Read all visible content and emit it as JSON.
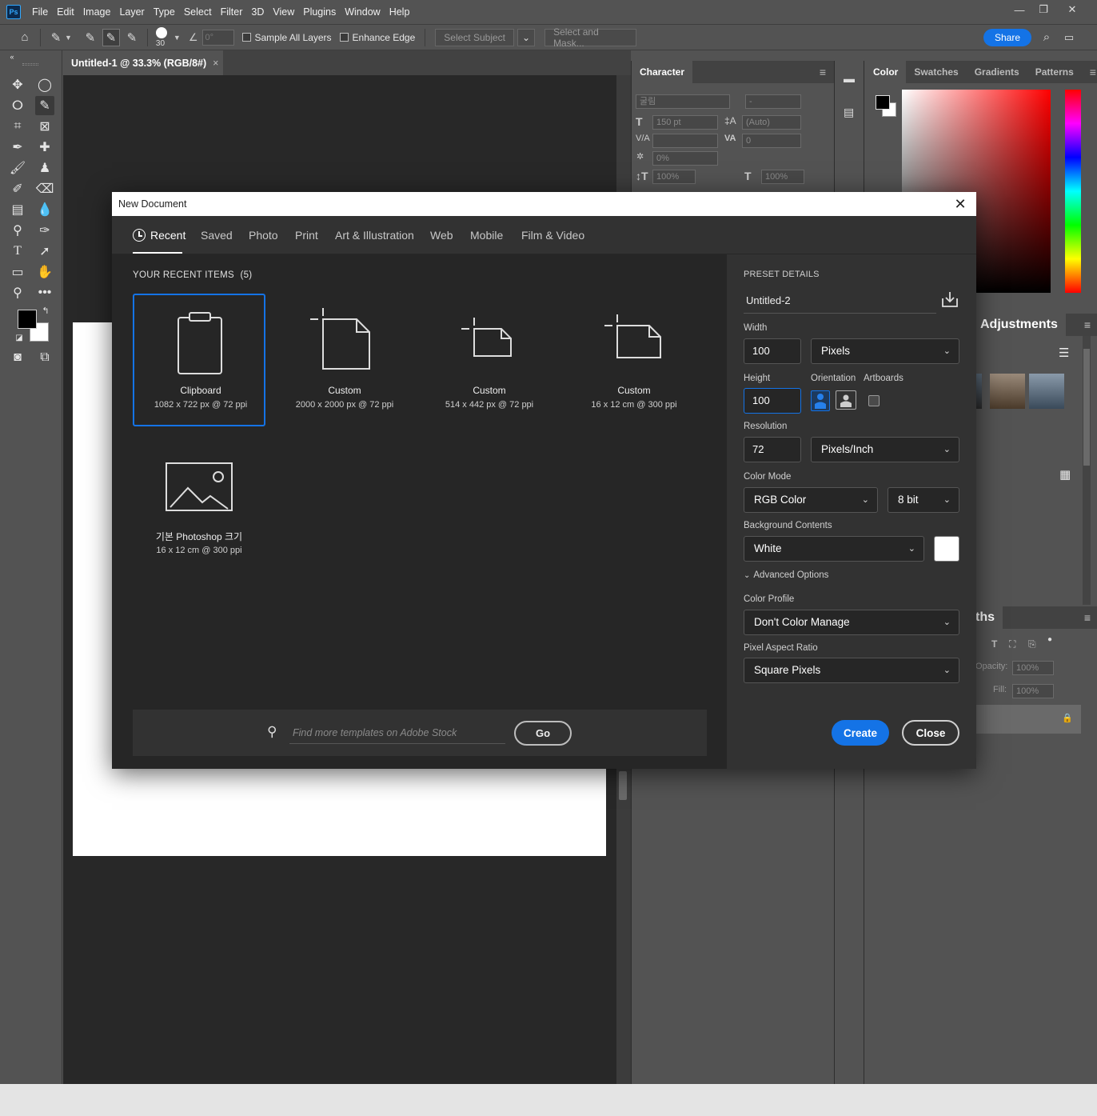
{
  "menubar": {
    "logo": "Ps",
    "items": [
      "File",
      "Edit",
      "Image",
      "Layer",
      "Type",
      "Select",
      "Filter",
      "3D",
      "View",
      "Plugins",
      "Window",
      "Help"
    ]
  },
  "options": {
    "brush_size": "30",
    "angle": "0°",
    "sample_all_layers": "Sample All Layers",
    "enhance_edge": "Enhance Edge",
    "select_subject": "Select Subject",
    "select_and_mask": "Select and Mask...",
    "share": "Share"
  },
  "document": {
    "tab_title": "Untitled-1 @ 33.3% (RGB/8#)",
    "tab_close": "×"
  },
  "character_panel": {
    "tab": "Character",
    "font_family": "굴림",
    "font_style": "-",
    "size": "150 pt",
    "leading": "(Auto)",
    "tracking": "0",
    "baseline": "0%",
    "vscale": "100%",
    "hscale": "100%"
  },
  "color_panel": {
    "tabs": [
      "Color",
      "Swatches",
      "Gradients",
      "Patterns"
    ],
    "adjustments_tab": "Adjustments",
    "paths_tab": "ths",
    "opacity_label": "Opacity:",
    "opacity": "100%",
    "fill_label": "Fill:",
    "fill": "100%",
    "colors": {
      "fg": "#000000",
      "bg": "#ffffff"
    }
  },
  "dialog": {
    "title": "New Document",
    "close": "✕",
    "tabs": [
      "Recent",
      "Saved",
      "Photo",
      "Print",
      "Art & Illustration",
      "Web",
      "Mobile",
      "Film & Video"
    ],
    "recent_heading": "YOUR RECENT ITEMS",
    "recent_count": "(5)",
    "items": [
      {
        "name": "Clipboard",
        "dims": "1082 x 722 px @ 72 ppi"
      },
      {
        "name": "Custom",
        "dims": "2000 x 2000 px @ 72 ppi"
      },
      {
        "name": "Custom",
        "dims": "514 x 442 px @ 72 ppi"
      },
      {
        "name": "Custom",
        "dims": "16 x 12 cm @ 300 ppi"
      },
      {
        "name": "기본 Photoshop 크기",
        "dims": "16 x 12 cm @ 300 ppi"
      }
    ],
    "search_placeholder": "Find more templates on Adobe Stock",
    "go": "Go",
    "preset": {
      "heading": "PRESET DETAILS",
      "name": "Untitled-2",
      "width_label": "Width",
      "width": "100",
      "width_unit": "Pixels",
      "height_label": "Height",
      "height": "100",
      "orientation_label": "Orientation",
      "artboards_label": "Artboards",
      "resolution_label": "Resolution",
      "resolution": "72",
      "resolution_unit": "Pixels/Inch",
      "color_mode_label": "Color Mode",
      "color_mode": "RGB Color",
      "bit_depth": "8 bit",
      "bg_label": "Background Contents",
      "bg": "White",
      "advanced": "Advanced Options",
      "profile_label": "Color Profile",
      "profile": "Don't Color Manage",
      "par_label": "Pixel Aspect Ratio",
      "par": "Square Pixels",
      "create": "Create",
      "close": "Close"
    }
  }
}
